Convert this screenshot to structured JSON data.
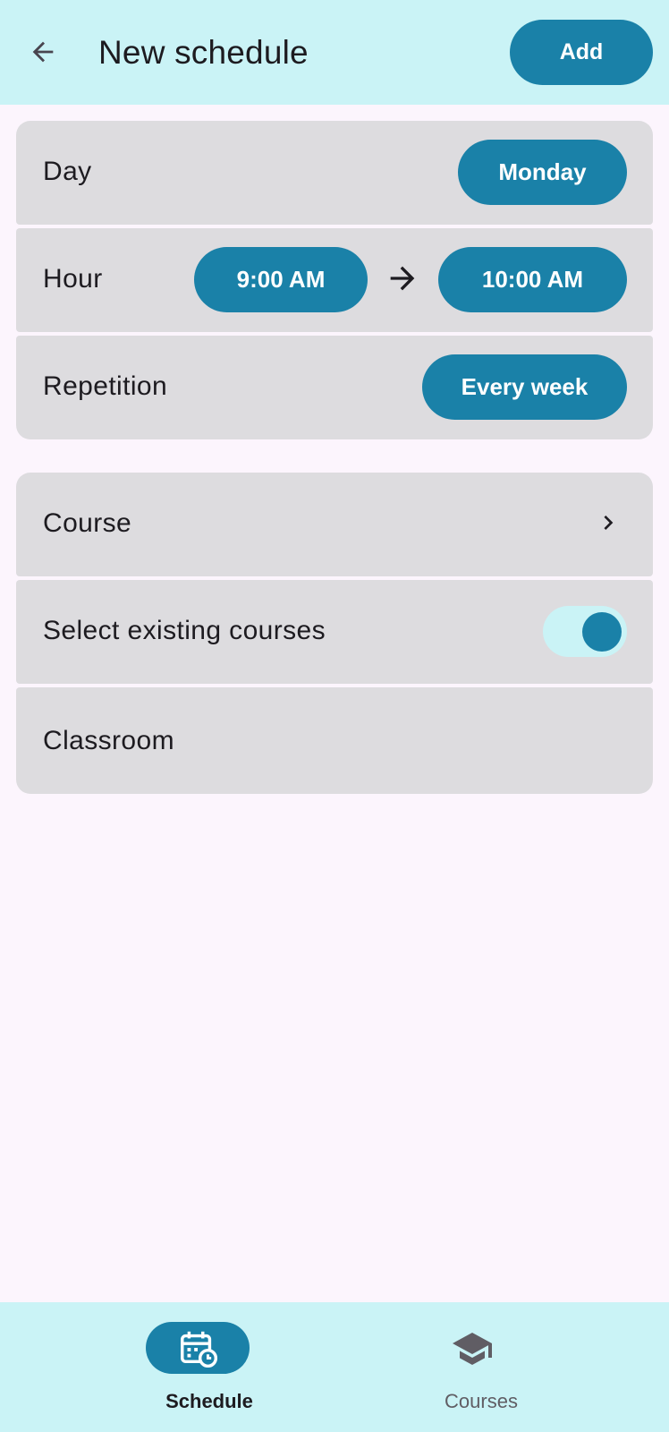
{
  "header": {
    "title": "New schedule",
    "back_icon": "arrow-back-icon",
    "add_label": "Add"
  },
  "schedule": {
    "day_label": "Day",
    "day_value": "Monday",
    "hour_label": "Hour",
    "hour_start": "9:00 AM",
    "hour_end": "10:00 AM",
    "range_icon": "arrow-right-icon",
    "repetition_label": "Repetition",
    "repetition_value": "Every week"
  },
  "course": {
    "course_label": "Course",
    "course_icon": "chevron-right-icon",
    "select_existing_label": "Select existing courses",
    "select_existing_on": true,
    "classroom_label": "Classroom"
  },
  "bottom_nav": {
    "items": [
      {
        "label": "Schedule",
        "icon": "calendar-clock-icon",
        "selected": true
      },
      {
        "label": "Courses",
        "icon": "graduation-cap-icon",
        "selected": false
      }
    ]
  },
  "colors": {
    "accent": "#1a81a8",
    "bar_background": "#caf3f6",
    "card_background": "#dddcdf",
    "page_background": "#fcf5fd"
  }
}
